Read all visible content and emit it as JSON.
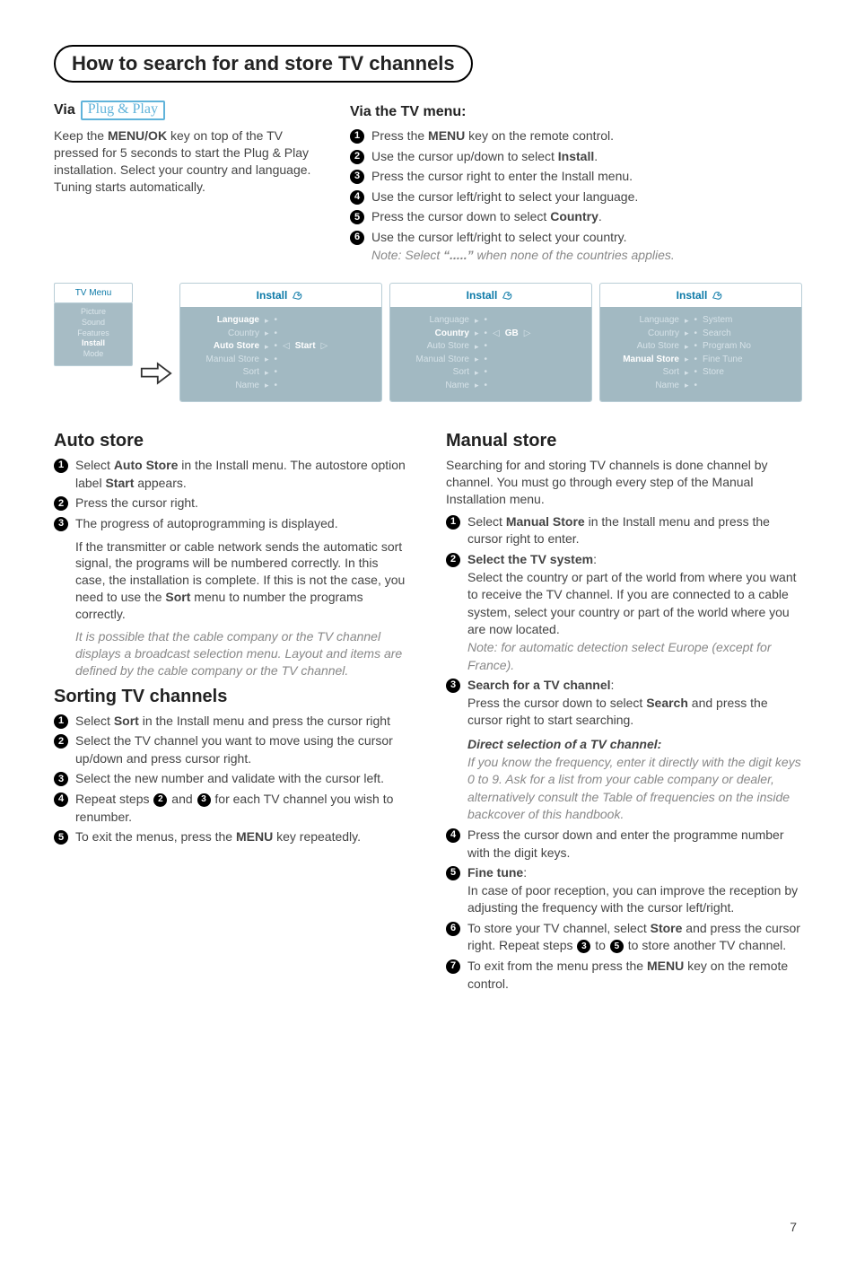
{
  "header": "How to search for and store TV channels",
  "left": {
    "via_label": "Via",
    "via_brand": "Plug & Play",
    "para": "Keep the <b>MENU/OK</b> key on top of the TV pressed for 5 seconds to start the Plug & Play installation. Select your country and language. Tuning starts automatically."
  },
  "right": {
    "title": "Via the TV menu:",
    "steps": [
      "Press the <b>MENU</b> key on the remote control.",
      "Use the cursor up/down to select <b>Install</b>.",
      "Press the cursor right to enter the Install menu.",
      "Use the cursor left/right to select your language.",
      "Press the cursor down to select <b>Country</b>.",
      "Use the cursor left/right to select your country.<br><span class=\"note\">Note: Select <b>“.....”</b> when none of the countries applies.</span>"
    ]
  },
  "tvmenu": {
    "header": "TV Menu",
    "items": [
      "Picture",
      "Sound",
      "Features",
      "Install",
      "Mode"
    ],
    "selected": "Install"
  },
  "panels": [
    {
      "title": "Install",
      "rows": [
        {
          "label": "Language",
          "on": true,
          "val": ""
        },
        {
          "label": "Country",
          "val": ""
        },
        {
          "label": "Auto Store",
          "on": true,
          "val": "Start",
          "valOn": true,
          "nav": true
        },
        {
          "label": "Manual Store",
          "val": ""
        },
        {
          "label": "Sort",
          "val": ""
        },
        {
          "label": "Name",
          "val": ""
        }
      ]
    },
    {
      "title": "Install",
      "rows": [
        {
          "label": "Language",
          "val": ""
        },
        {
          "label": "Country",
          "on": true,
          "val": "GB",
          "valOn": true,
          "nav": true
        },
        {
          "label": "Auto Store",
          "val": ""
        },
        {
          "label": "Manual Store",
          "val": ""
        },
        {
          "label": "Sort",
          "val": ""
        },
        {
          "label": "Name",
          "val": ""
        }
      ]
    },
    {
      "title": "Install",
      "rows": [
        {
          "label": "Language",
          "val": "System"
        },
        {
          "label": "Country",
          "val": "Search"
        },
        {
          "label": "Auto Store",
          "val": "Program No"
        },
        {
          "label": "Manual Store",
          "on": true,
          "val": "Fine Tune"
        },
        {
          "label": "Sort",
          "val": "Store"
        },
        {
          "label": "Name",
          "val": ""
        }
      ]
    }
  ],
  "auto": {
    "title": "Auto store",
    "steps": [
      "Select <b>Auto Store</b> in the Install menu. The autostore option label <b>Start</b> appears.",
      "Press the cursor right.",
      "The progress of autoprogramming is displayed."
    ],
    "tail": "If the transmitter or cable network sends the automatic sort signal, the programs will be numbered correctly. In this case, the installation is complete. If this is not the case, you need to use the <b>Sort</b> menu to number the programs correctly.",
    "tailnote": "It is possible that the cable company or the TV channel displays a broadcast selection menu. Layout and items are defined by the cable company or the TV channel."
  },
  "sort": {
    "title": "Sorting TV channels",
    "steps": [
      "Select <b>Sort</b> in the Install menu and press the cursor right",
      "Select the TV channel you want to move using the cursor up/down and press cursor right.",
      "Select the new number and validate with the cursor left.",
      "Repeat steps {2} and {3} for each TV channel you wish to renumber.",
      "To exit the menus, press the <b>MENU</b> key repeatedly."
    ]
  },
  "manual": {
    "title": "Manual store",
    "intro": "Searching for and storing TV channels is done channel by channel. You must go through every step of the Manual Installation menu.",
    "steps": [
      "Select <b>Manual Store</b> in the Install menu and press the cursor right to enter.",
      "<b>Select the TV system</b>:<br>Select the country or part of the world from where you want to receive the TV channel. If you are connected to a cable system, select your country or part of the world where you are now located.<br><span class=\"note\">Note: for automatic detection select Europe (except for France).</span>",
      "<b>Search for a TV channel</b>:<br>Press the cursor down to select <b>Search</b> and press the cursor right to start searching.",
      "Press the cursor down and enter the programme number with the digit keys.",
      "<b>Fine tune</b>:<br>In case of poor reception, you can improve the reception by adjusting the frequency with the cursor left/right.",
      "To store your TV channel, select <b>Store</b> and press the cursor right. Repeat steps {3} to {5} to store another TV channel.",
      "To exit from the menu press the <b>MENU</b> key on the remote control."
    ],
    "direct_title": "Direct selection of a TV channel:",
    "direct_body": "If you know the frequency, enter it directly with the digit keys 0 to 9. Ask for a list from your cable company or dealer, alternatively consult the Table of frequencies on the inside backcover of this handbook."
  },
  "pagenum": "7"
}
